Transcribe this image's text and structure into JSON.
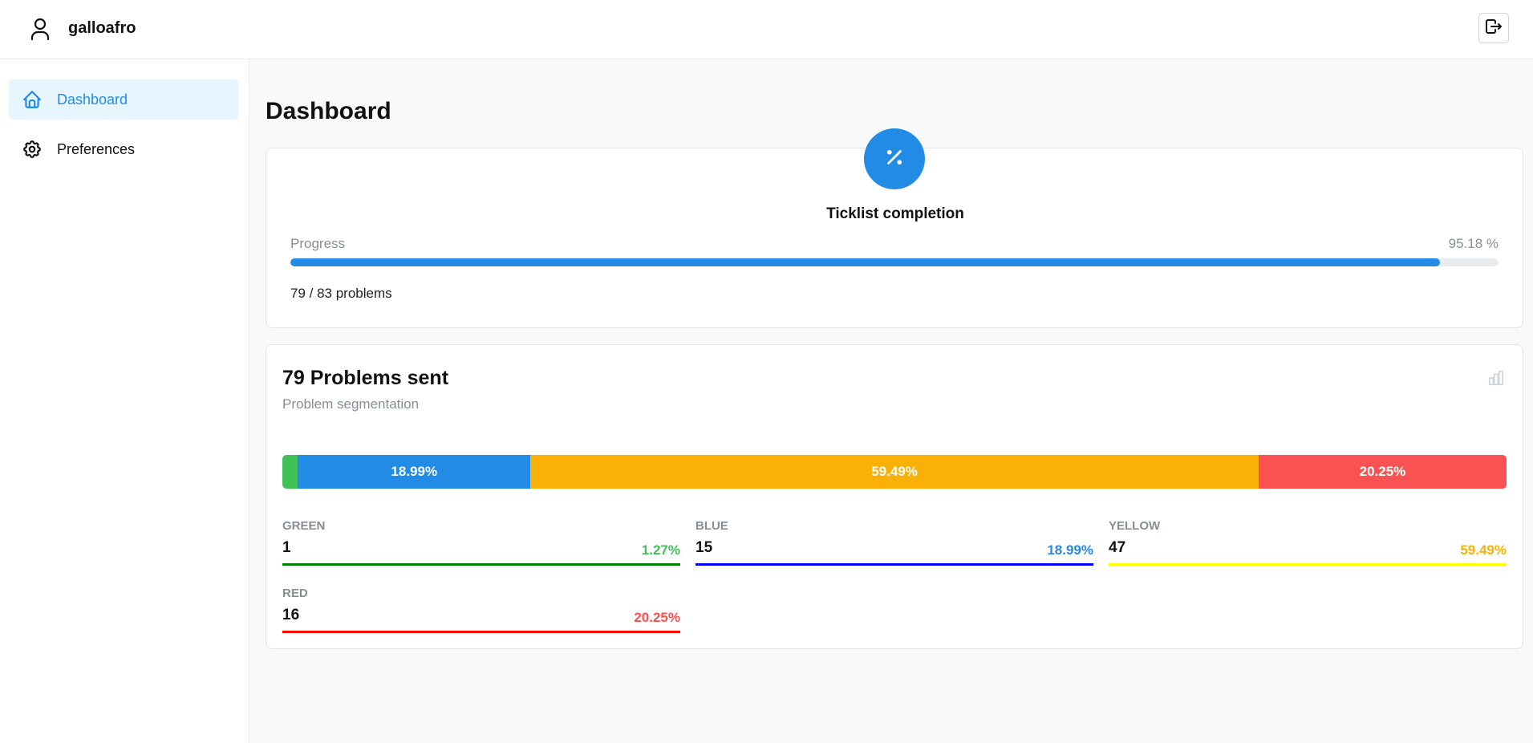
{
  "header": {
    "username": "galloafro",
    "user_icon": "user-icon",
    "logout_icon": "logout-icon"
  },
  "sidebar": {
    "items": [
      {
        "label": "Dashboard",
        "icon": "home-icon",
        "active": true
      },
      {
        "label": "Preferences",
        "icon": "gear-icon",
        "active": false
      }
    ]
  },
  "page": {
    "title": "Dashboard"
  },
  "ticklist": {
    "icon": "percent-icon",
    "title": "Ticklist completion",
    "progress_label": "Progress",
    "progress_value": "95.18 %",
    "progress_fraction": 0.9518,
    "problems_text": "79 / 83 problems"
  },
  "segmentation": {
    "title": "79 Problems sent",
    "subtitle": "Problem segmentation",
    "icon": "bar-chart-icon",
    "bar": [
      {
        "color": "#40c057",
        "fraction": 0.0127,
        "label": ""
      },
      {
        "color": "#228be6",
        "fraction": 0.1899,
        "label": "18.99%"
      },
      {
        "color": "#fab005",
        "fraction": 0.5949,
        "label": "59.49%"
      },
      {
        "color": "#fa5252",
        "fraction": 0.2025,
        "label": "20.25%"
      }
    ],
    "stats": [
      {
        "label": "GREEN",
        "value": "1",
        "pct": "1.27%",
        "pct_color": "#40c057",
        "line_color": "#008000"
      },
      {
        "label": "BLUE",
        "value": "15",
        "pct": "18.99%",
        "pct_color": "#228be6",
        "line_color": "#0000ff"
      },
      {
        "label": "YELLOW",
        "value": "47",
        "pct": "59.49%",
        "pct_color": "#fab005",
        "line_color": "#ffff00"
      },
      {
        "label": "RED",
        "value": "16",
        "pct": "20.25%",
        "pct_color": "#fa5252",
        "line_color": "#ff0000"
      }
    ]
  }
}
